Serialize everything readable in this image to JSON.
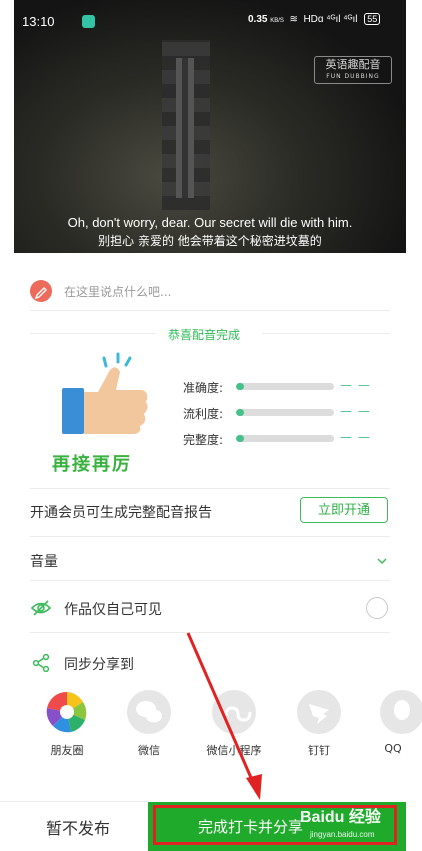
{
  "status_bar": {
    "time": "13:10",
    "speed": "0.35",
    "speed_unit": "KB/S",
    "network": "HDɑ ⁴ᴳıl ⁴ᴳıl",
    "battery": "55"
  },
  "video": {
    "badge_main": "英语趣配音",
    "badge_sub": "FUN DUBBING",
    "subtitle_en": "Oh, don't worry, dear. Our secret will die with him.",
    "subtitle_zh": "别担心  亲爱的 他会带着这个秘密进坟墓的"
  },
  "comment": {
    "placeholder": "在这里说点什么吧..."
  },
  "result": {
    "title": "恭喜配音完成",
    "encourage": "再接再厉",
    "metrics": [
      {
        "label": "准确度:",
        "value": "— —",
        "fill": 0.08
      },
      {
        "label": "流利度:",
        "value": "— —",
        "fill": 0.08
      },
      {
        "label": "完整度:",
        "value": "— —",
        "fill": 0.08
      }
    ]
  },
  "vip": {
    "text": "开通会员可生成完整配音报告",
    "button": "立即开通"
  },
  "volume": {
    "label": "音量"
  },
  "privacy": {
    "label": "作品仅自己可见"
  },
  "share": {
    "label": "同步分享到",
    "apps": [
      {
        "label": "朋友圈",
        "icon": "moments-icon"
      },
      {
        "label": "微信",
        "icon": "wechat-icon"
      },
      {
        "label": "微信小程序",
        "icon": "mini-program-icon"
      },
      {
        "label": "钉钉",
        "icon": "dingtalk-icon"
      },
      {
        "label": "QQ",
        "icon": "qq-icon"
      }
    ]
  },
  "bottom": {
    "cancel": "暂不发布",
    "confirm": "完成打卡并分享"
  },
  "watermark": {
    "main": "Baidu 经验",
    "sub": "jingyan.baidu.com"
  },
  "colors": {
    "accent": "#1faa2c",
    "progress": "#46c08a",
    "highlight": "#e02222"
  }
}
